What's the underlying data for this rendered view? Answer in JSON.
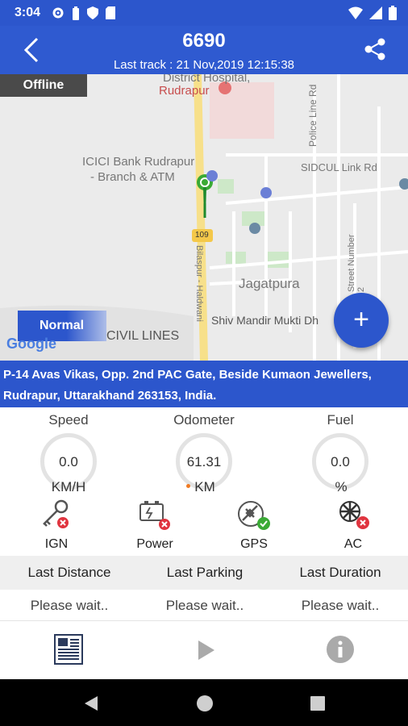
{
  "status_bar": {
    "time": "3:04"
  },
  "header": {
    "title": "6690",
    "subtitle": "Last track : 21 Nov,2019 12:15:38"
  },
  "map": {
    "offline_label": "Offline",
    "map_type": "Normal",
    "google_logo": "Google",
    "labels": {
      "hospital": "District Hospital,",
      "rudrapur": "Rudrapur",
      "icici": "ICICI Bank Rudrapur",
      "icici2": "- Branch & ATM",
      "sidcul": "SIDCUL Link Rd",
      "police": "Police Line Rd",
      "jagatpura": "Jagatpura",
      "shiv": "Shiv Mandir Mukti Dh",
      "civil": "CIVIL LINES",
      "bilaspur": "Bilaspur - Haldwani",
      "street": "Street Number 2",
      "route": "109"
    },
    "fab_label": "+"
  },
  "address": "P-14 Avas Vikas, Opp. 2nd PAC Gate, Beside Kumaon Jewellers, Rudrapur, Uttarakhand 263153, India.",
  "gauges": [
    {
      "label": "Speed",
      "value": "0.0",
      "unit": "KM/H"
    },
    {
      "label": "Odometer",
      "value": "61.31",
      "unit": "KM"
    },
    {
      "label": "Fuel",
      "value": "0.0",
      "unit": "%"
    }
  ],
  "statuses": [
    {
      "label": "IGN",
      "icon": "key-icon",
      "state": "off"
    },
    {
      "label": "Power",
      "icon": "battery-icon",
      "state": "off"
    },
    {
      "label": "GPS",
      "icon": "satellite-icon",
      "state": "on"
    },
    {
      "label": "AC",
      "icon": "snowflake-icon",
      "state": "off"
    }
  ],
  "last_table": {
    "headers": [
      "Last Distance",
      "Last Parking",
      "Last Duration"
    ],
    "values": [
      "Please wait..",
      "Please wait..",
      "Please wait.."
    ]
  },
  "colors": {
    "primary": "#2c56cc",
    "ok": "#3aaa35",
    "error": "#e0343f"
  }
}
